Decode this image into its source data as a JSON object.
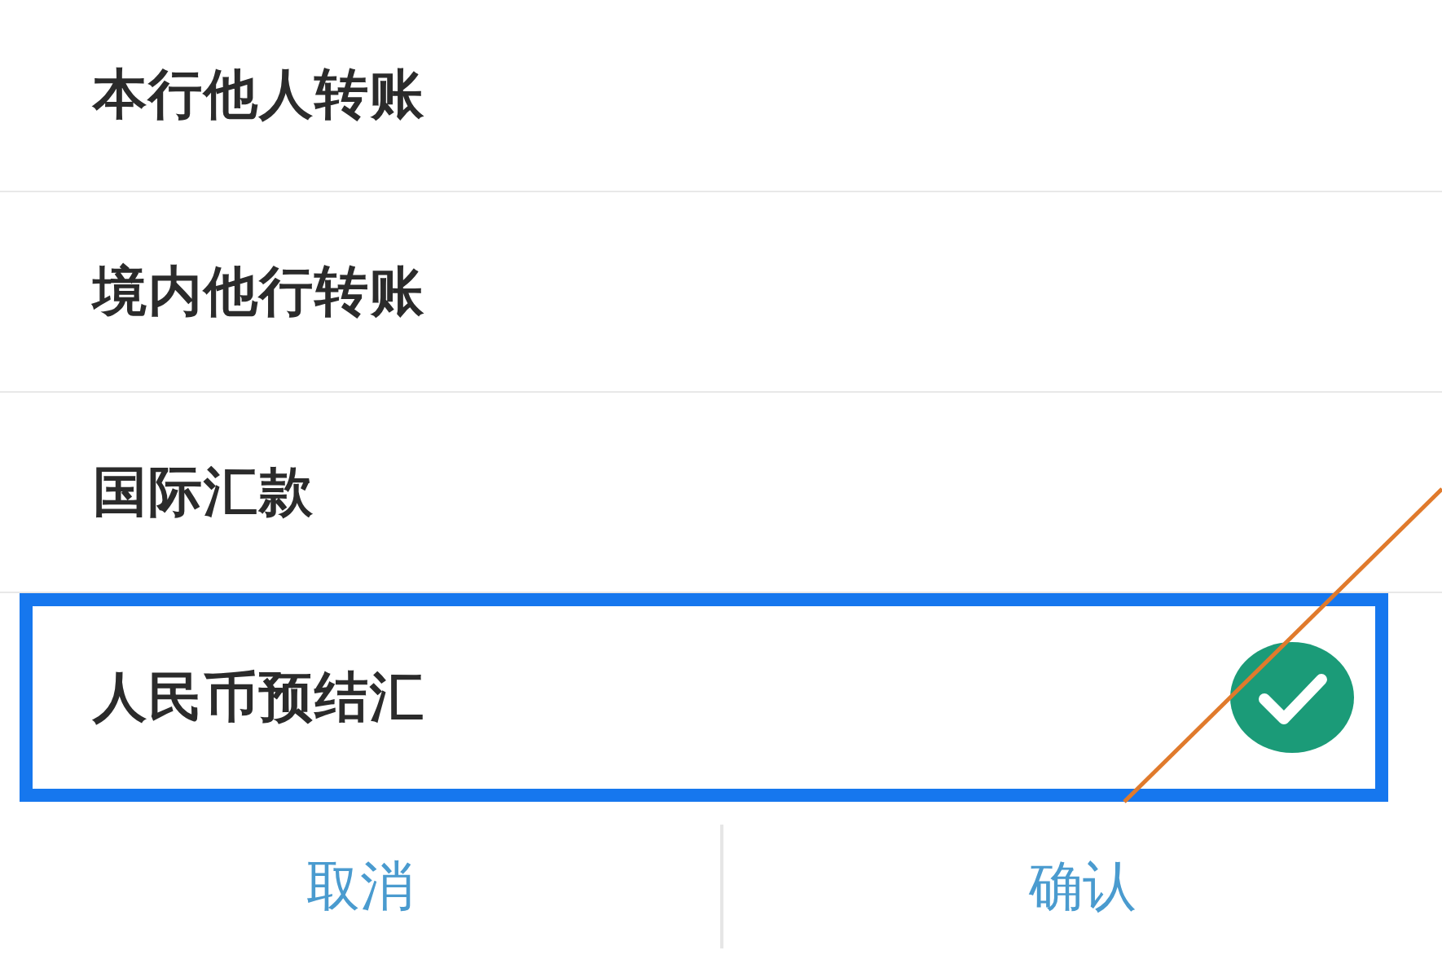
{
  "options": [
    {
      "label": "本行他人转账",
      "selected": false
    },
    {
      "label": "境内他行转账",
      "selected": false
    },
    {
      "label": "国际汇款",
      "selected": false
    },
    {
      "label": "人民币预结汇",
      "selected": true
    }
  ],
  "buttons": [
    {
      "label": "取消"
    },
    {
      "label": "确认"
    }
  ]
}
